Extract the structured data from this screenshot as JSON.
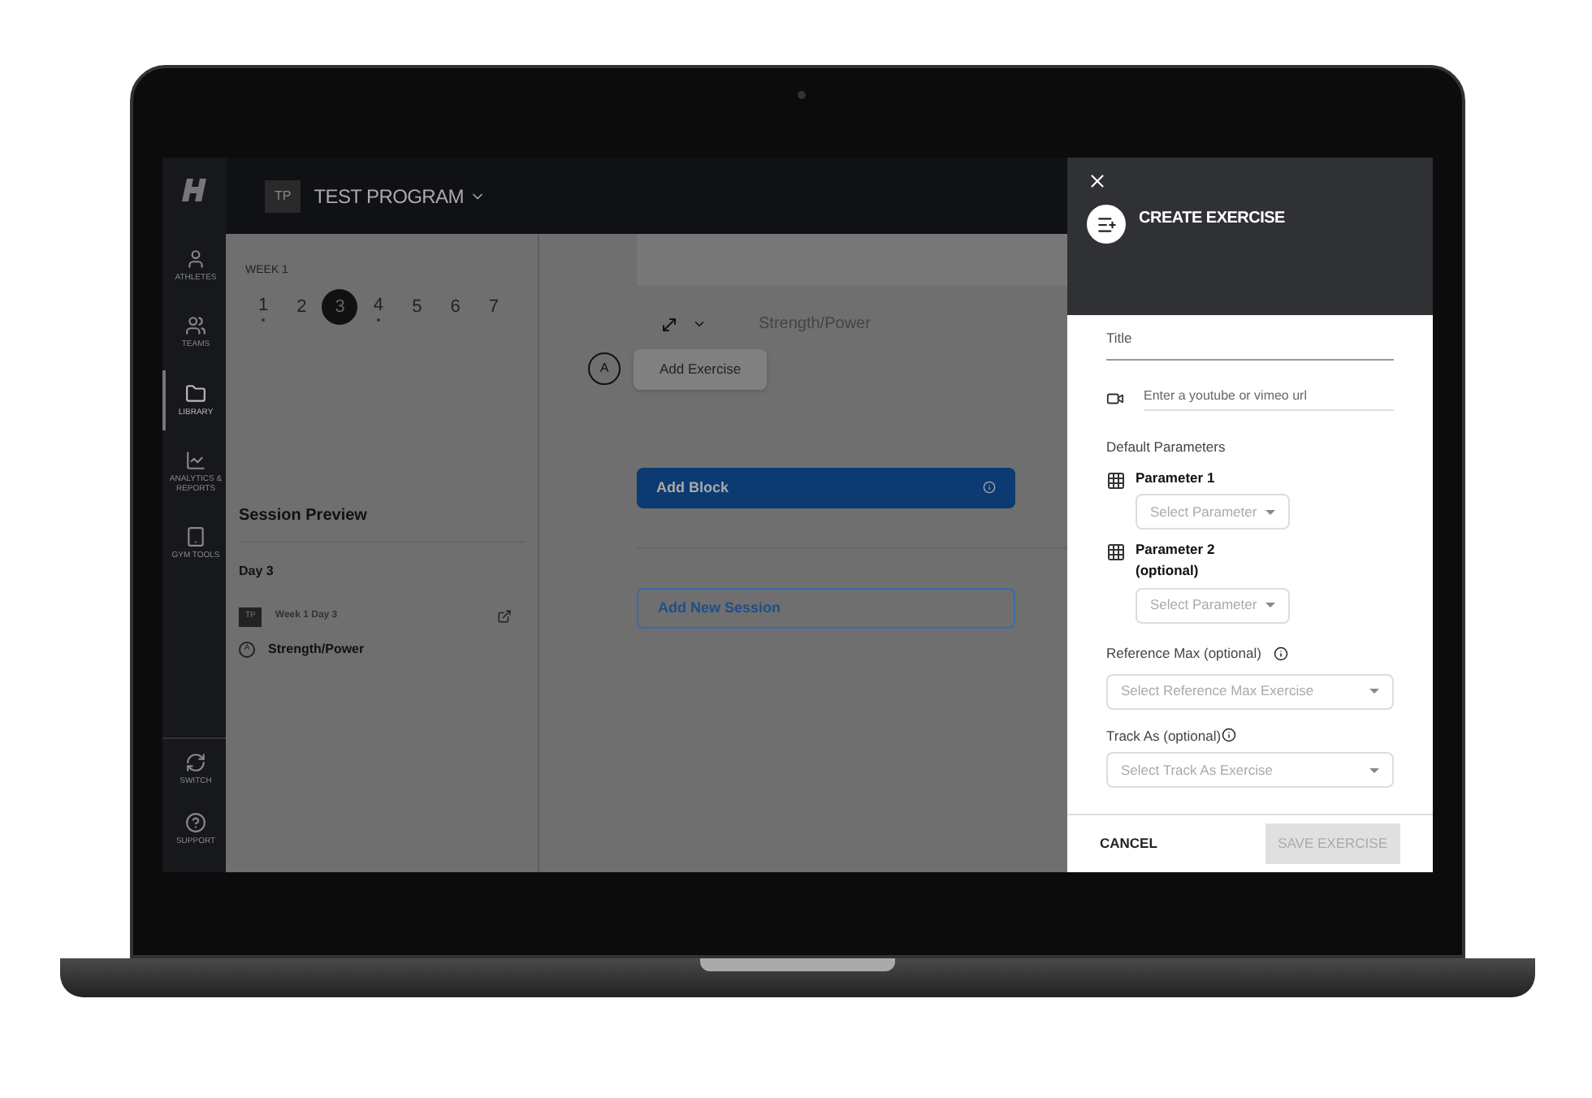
{
  "top_bar": {
    "program_badge": "TP",
    "program_name": "TEST PROGRAM"
  },
  "sidebar": {
    "items": [
      {
        "kind": "athletes",
        "label": "ATHLETES",
        "selected": false
      },
      {
        "kind": "teams",
        "label": "TEAMS",
        "selected": false
      },
      {
        "kind": "library",
        "label": "LIBRARY",
        "selected": true
      },
      {
        "kind": "analytics",
        "label": "ANALYTICS & REPORTS",
        "selected": false
      },
      {
        "kind": "gym",
        "label": "GYM TOOLS",
        "selected": false
      }
    ],
    "bottom_items": [
      {
        "kind": "switch",
        "label": "SWITCH"
      },
      {
        "kind": "support",
        "label": "SUPPORT"
      }
    ]
  },
  "week": {
    "label": "WEEK 1",
    "days": [
      {
        "label": "1",
        "selected": false,
        "has_session": true
      },
      {
        "label": "2",
        "selected": false,
        "has_session": false
      },
      {
        "label": "3",
        "selected": true,
        "has_session": false
      },
      {
        "label": "4",
        "selected": false,
        "has_session": true
      },
      {
        "label": "5",
        "selected": false,
        "has_session": false
      },
      {
        "label": "6",
        "selected": false,
        "has_session": false
      },
      {
        "label": "7",
        "selected": false,
        "has_session": false
      }
    ]
  },
  "session_preview": {
    "title": "Session Preview",
    "day": "Day 3",
    "badge": "TP",
    "session_name": "Week 1 Day 3",
    "block_letter": "A",
    "block_name": "Strength/Power"
  },
  "main": {
    "block_name": "Strength/Power",
    "block_letter": "A",
    "add_exercise": "Add Exercise",
    "add_block": "Add Block",
    "add_session": "Add New Session"
  },
  "drawer": {
    "title": "CREATE EXERCISE",
    "title_field": {
      "placeholder": "Title"
    },
    "video_field": {
      "placeholder": "Enter a youtube or vimeo url"
    },
    "parameters_label": "Default Parameters",
    "parameters": [
      {
        "label": "Parameter 1",
        "placeholder": "Select Parameter"
      },
      {
        "label": "Parameter 2 (optional)",
        "placeholder": "Select Parameter"
      }
    ],
    "reference_max": {
      "label": "Reference Max (optional)",
      "placeholder": "Select Reference Max Exercise"
    },
    "track_as": {
      "label": "Track As (optional)",
      "placeholder": "Select Track As Exercise"
    },
    "cancel": "CANCEL",
    "save": {
      "label": "SAVE EXERCISE",
      "disabled": true
    }
  }
}
